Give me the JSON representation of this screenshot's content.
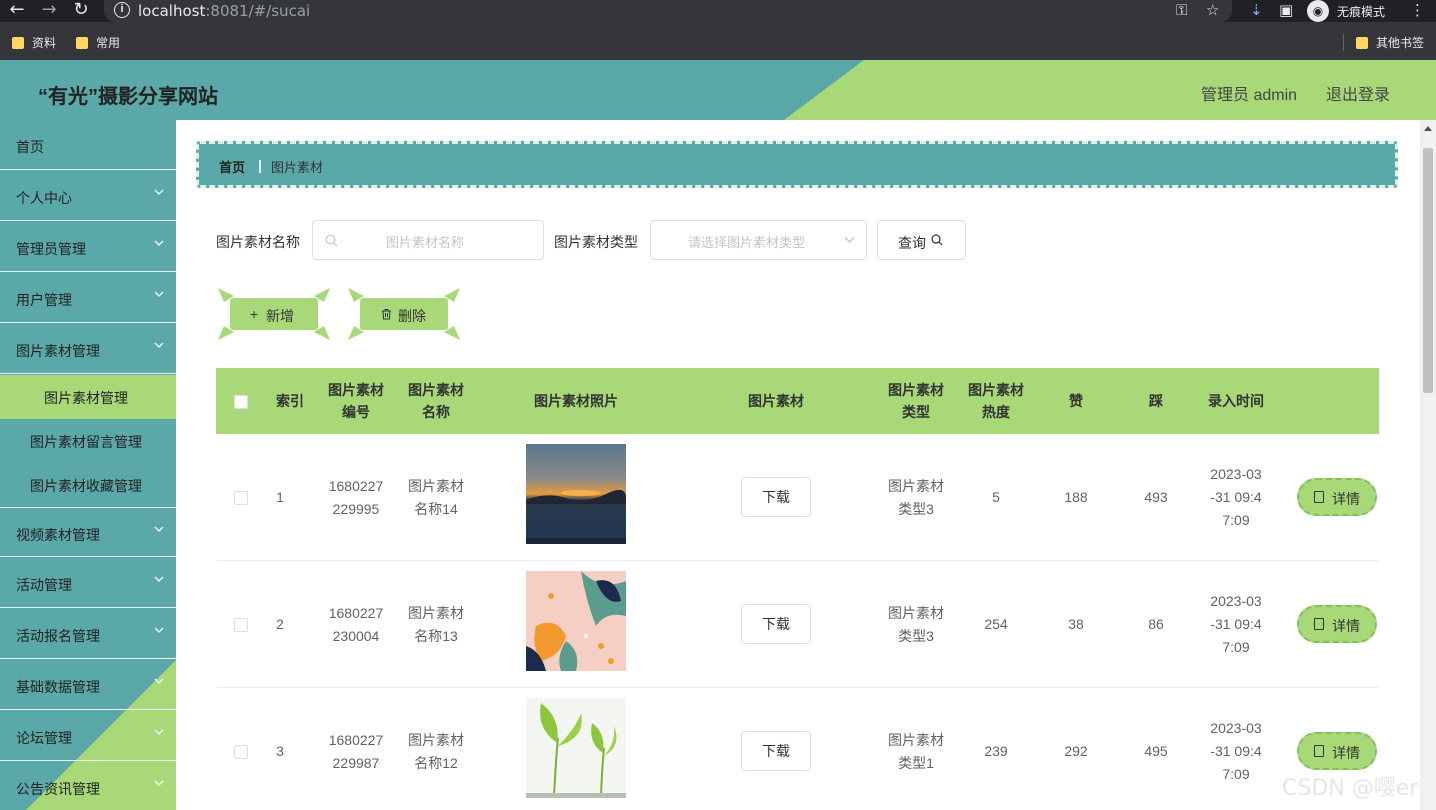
{
  "browser": {
    "url_host": "localhost",
    "url_rest": ":8081/#/sucai",
    "incognito_label": "无痕模式",
    "bookmarks": [
      "资料",
      "常用"
    ],
    "other_bookmarks": "其他书签"
  },
  "header": {
    "title": "“有光”摄影分享网站",
    "user": "管理员 admin",
    "logout": "退出登录"
  },
  "sidebar": {
    "items": [
      {
        "label": "首页"
      },
      {
        "label": "个人中心"
      },
      {
        "label": "管理员管理"
      },
      {
        "label": "用户管理"
      },
      {
        "label": "图片素材管理"
      }
    ],
    "sub_items": [
      {
        "label": "图片素材管理"
      },
      {
        "label": "图片素材留言管理"
      },
      {
        "label": "图片素材收藏管理"
      }
    ],
    "items_after": [
      {
        "label": "视频素材管理"
      },
      {
        "label": "活动管理"
      },
      {
        "label": "活动报名管理"
      },
      {
        "label": "基础数据管理"
      },
      {
        "label": "论坛管理"
      },
      {
        "label": "公告资讯管理"
      }
    ]
  },
  "breadcrumb": {
    "home": "首页",
    "separator": "|",
    "current": "图片素材"
  },
  "search": {
    "name_label": "图片素材名称",
    "name_placeholder": "图片素材名称",
    "type_label": "图片素材类型",
    "type_placeholder": "请选择图片素材类型",
    "query_button": "查询"
  },
  "actions": {
    "add": "新增",
    "delete": "删除"
  },
  "table": {
    "headers": [
      "索引",
      "图片素材编号",
      "图片素材名称",
      "图片素材照片",
      "图片素材",
      "图片素材类型",
      "图片素材热度",
      "赞",
      "踩",
      "录入时间"
    ],
    "header_lines": {
      "code": [
        "图片素材",
        "编号"
      ],
      "name": [
        "图片素材",
        "名称"
      ],
      "type": [
        "图片素材",
        "类型"
      ],
      "heat": [
        "图片素材",
        "热度"
      ]
    },
    "download_label": "下载",
    "detail_label": "详情",
    "rows": [
      {
        "index": "1",
        "code": [
          "1680227",
          "229995"
        ],
        "name": [
          "图片素材",
          "名称14"
        ],
        "photo": "sunset",
        "type": [
          "图片素材",
          "类型3"
        ],
        "heat": "5",
        "likes": "188",
        "dislikes": "493",
        "time": [
          "2023-03",
          "-31 09:4",
          "7:09"
        ]
      },
      {
        "index": "2",
        "code": [
          "1680227",
          "230004"
        ],
        "name": [
          "图片素材",
          "名称13"
        ],
        "photo": "pattern",
        "type": [
          "图片素材",
          "类型3"
        ],
        "heat": "254",
        "likes": "38",
        "dislikes": "86",
        "time": [
          "2023-03",
          "-31 09:4",
          "7:09"
        ]
      },
      {
        "index": "3",
        "code": [
          "1680227",
          "229987"
        ],
        "name": [
          "图片素材",
          "名称12"
        ],
        "photo": "sprouts",
        "type": [
          "图片素材",
          "类型1"
        ],
        "heat": "239",
        "likes": "292",
        "dislikes": "495",
        "time": [
          "2023-03",
          "-31 09:4",
          "7:09"
        ]
      }
    ]
  },
  "colors": {
    "teal": "#5aa8a8",
    "green": "#a8d878"
  },
  "watermark": "CSDN @嘤er"
}
